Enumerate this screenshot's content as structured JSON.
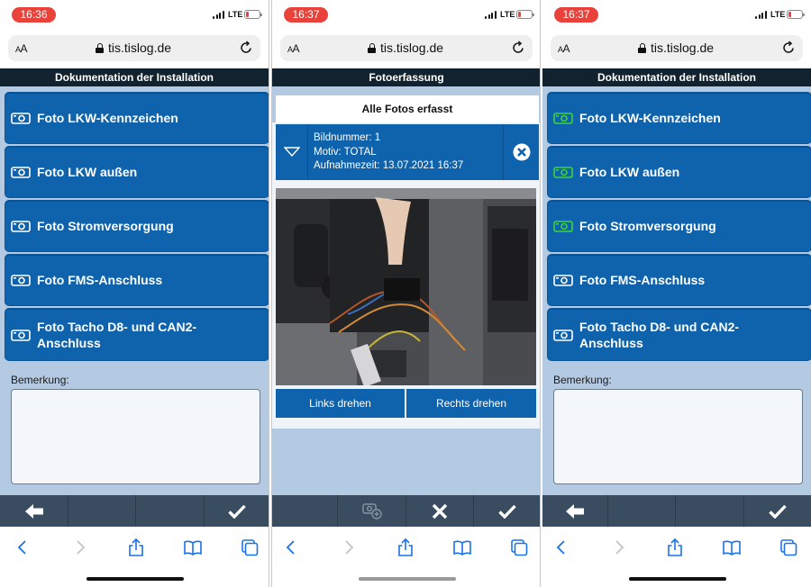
{
  "screens": [
    {
      "status": {
        "time": "16:36",
        "network": "LTE"
      },
      "browser": {
        "text_size": "AA",
        "url": "tis.tislog.de"
      },
      "header": "Dokumentation der Installation",
      "photo_buttons": [
        {
          "label": "Foto LKW-Kennzeichen",
          "icon_color": "#ffffff"
        },
        {
          "label": "Foto LKW außen",
          "icon_color": "#ffffff"
        },
        {
          "label": "Foto Stromversorgung",
          "icon_color": "#ffffff"
        },
        {
          "label": "Foto FMS-Anschluss",
          "icon_color": "#ffffff"
        },
        {
          "label": "Foto Tacho D8- und CAN2-\nAnschluss",
          "icon_color": "#ffffff"
        }
      ],
      "remark_label": "Bemerkung:",
      "remark_value": ""
    },
    {
      "status": {
        "time": "16:37",
        "network": "LTE"
      },
      "browser": {
        "text_size": "AA",
        "url": "tis.tislog.de"
      },
      "header": "Fotoerfassung",
      "all_photos_title": "Alle Fotos erfasst",
      "photo_info": {
        "number": "Bildnummer: 1",
        "motif": "Motiv: TOTAL",
        "time": "Aufnahmezeit: 13.07.2021 16:37"
      },
      "rotate_left": "Links drehen",
      "rotate_right": "Rechts drehen"
    },
    {
      "status": {
        "time": "16:37",
        "network": "LTE"
      },
      "browser": {
        "text_size": "AA",
        "url": "tis.tislog.de"
      },
      "header": "Dokumentation der Installation",
      "photo_buttons": [
        {
          "label": "Foto LKW-Kennzeichen",
          "icon_color": "#3fd13f"
        },
        {
          "label": "Foto LKW außen",
          "icon_color": "#3fd13f"
        },
        {
          "label": "Foto Stromversorgung",
          "icon_color": "#3fd13f"
        },
        {
          "label": "Foto FMS-Anschluss",
          "icon_color": "#ffffff"
        },
        {
          "label": "Foto Tacho D8- und CAN2-\nAnschluss",
          "icon_color": "#ffffff"
        }
      ],
      "remark_label": "Bemerkung:",
      "remark_value": ""
    }
  ],
  "colors": {
    "button_blue": "#0f62ac",
    "content_bg": "#b4cae3",
    "header_bg": "#12232f",
    "toolbar_bg": "#3a4d60",
    "time_pill": "#e8423a",
    "done_icon": "#3fd13f"
  },
  "icons": {
    "toolbar_left": [
      "back-arrow-icon",
      "",
      "",
      "checkmark-icon"
    ],
    "toolbar_middle": [
      "",
      "add-photo-icon",
      "close-icon",
      "checkmark-icon"
    ],
    "safari": [
      "back-chevron-icon",
      "forward-chevron-icon",
      "share-icon",
      "bookmarks-icon",
      "tabs-icon"
    ]
  }
}
